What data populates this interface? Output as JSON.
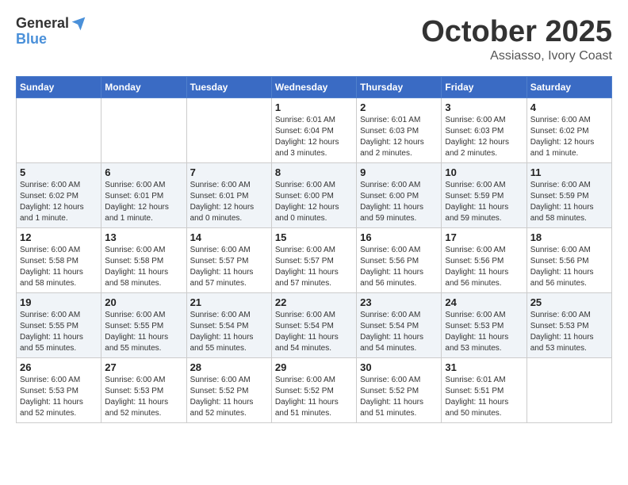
{
  "logo": {
    "general": "General",
    "blue": "Blue"
  },
  "title": "October 2025",
  "location": "Assiasso, Ivory Coast",
  "days_header": [
    "Sunday",
    "Monday",
    "Tuesday",
    "Wednesday",
    "Thursday",
    "Friday",
    "Saturday"
  ],
  "weeks": [
    [
      {
        "day": "",
        "info": ""
      },
      {
        "day": "",
        "info": ""
      },
      {
        "day": "",
        "info": ""
      },
      {
        "day": "1",
        "info": "Sunrise: 6:01 AM\nSunset: 6:04 PM\nDaylight: 12 hours and 3 minutes."
      },
      {
        "day": "2",
        "info": "Sunrise: 6:01 AM\nSunset: 6:03 PM\nDaylight: 12 hours and 2 minutes."
      },
      {
        "day": "3",
        "info": "Sunrise: 6:00 AM\nSunset: 6:03 PM\nDaylight: 12 hours and 2 minutes."
      },
      {
        "day": "4",
        "info": "Sunrise: 6:00 AM\nSunset: 6:02 PM\nDaylight: 12 hours and 1 minute."
      }
    ],
    [
      {
        "day": "5",
        "info": "Sunrise: 6:00 AM\nSunset: 6:02 PM\nDaylight: 12 hours and 1 minute."
      },
      {
        "day": "6",
        "info": "Sunrise: 6:00 AM\nSunset: 6:01 PM\nDaylight: 12 hours and 1 minute."
      },
      {
        "day": "7",
        "info": "Sunrise: 6:00 AM\nSunset: 6:01 PM\nDaylight: 12 hours and 0 minutes."
      },
      {
        "day": "8",
        "info": "Sunrise: 6:00 AM\nSunset: 6:00 PM\nDaylight: 12 hours and 0 minutes."
      },
      {
        "day": "9",
        "info": "Sunrise: 6:00 AM\nSunset: 6:00 PM\nDaylight: 11 hours and 59 minutes."
      },
      {
        "day": "10",
        "info": "Sunrise: 6:00 AM\nSunset: 5:59 PM\nDaylight: 11 hours and 59 minutes."
      },
      {
        "day": "11",
        "info": "Sunrise: 6:00 AM\nSunset: 5:59 PM\nDaylight: 11 hours and 58 minutes."
      }
    ],
    [
      {
        "day": "12",
        "info": "Sunrise: 6:00 AM\nSunset: 5:58 PM\nDaylight: 11 hours and 58 minutes."
      },
      {
        "day": "13",
        "info": "Sunrise: 6:00 AM\nSunset: 5:58 PM\nDaylight: 11 hours and 58 minutes."
      },
      {
        "day": "14",
        "info": "Sunrise: 6:00 AM\nSunset: 5:57 PM\nDaylight: 11 hours and 57 minutes."
      },
      {
        "day": "15",
        "info": "Sunrise: 6:00 AM\nSunset: 5:57 PM\nDaylight: 11 hours and 57 minutes."
      },
      {
        "day": "16",
        "info": "Sunrise: 6:00 AM\nSunset: 5:56 PM\nDaylight: 11 hours and 56 minutes."
      },
      {
        "day": "17",
        "info": "Sunrise: 6:00 AM\nSunset: 5:56 PM\nDaylight: 11 hours and 56 minutes."
      },
      {
        "day": "18",
        "info": "Sunrise: 6:00 AM\nSunset: 5:56 PM\nDaylight: 11 hours and 56 minutes."
      }
    ],
    [
      {
        "day": "19",
        "info": "Sunrise: 6:00 AM\nSunset: 5:55 PM\nDaylight: 11 hours and 55 minutes."
      },
      {
        "day": "20",
        "info": "Sunrise: 6:00 AM\nSunset: 5:55 PM\nDaylight: 11 hours and 55 minutes."
      },
      {
        "day": "21",
        "info": "Sunrise: 6:00 AM\nSunset: 5:54 PM\nDaylight: 11 hours and 55 minutes."
      },
      {
        "day": "22",
        "info": "Sunrise: 6:00 AM\nSunset: 5:54 PM\nDaylight: 11 hours and 54 minutes."
      },
      {
        "day": "23",
        "info": "Sunrise: 6:00 AM\nSunset: 5:54 PM\nDaylight: 11 hours and 54 minutes."
      },
      {
        "day": "24",
        "info": "Sunrise: 6:00 AM\nSunset: 5:53 PM\nDaylight: 11 hours and 53 minutes."
      },
      {
        "day": "25",
        "info": "Sunrise: 6:00 AM\nSunset: 5:53 PM\nDaylight: 11 hours and 53 minutes."
      }
    ],
    [
      {
        "day": "26",
        "info": "Sunrise: 6:00 AM\nSunset: 5:53 PM\nDaylight: 11 hours and 52 minutes."
      },
      {
        "day": "27",
        "info": "Sunrise: 6:00 AM\nSunset: 5:53 PM\nDaylight: 11 hours and 52 minutes."
      },
      {
        "day": "28",
        "info": "Sunrise: 6:00 AM\nSunset: 5:52 PM\nDaylight: 11 hours and 52 minutes."
      },
      {
        "day": "29",
        "info": "Sunrise: 6:00 AM\nSunset: 5:52 PM\nDaylight: 11 hours and 51 minutes."
      },
      {
        "day": "30",
        "info": "Sunrise: 6:00 AM\nSunset: 5:52 PM\nDaylight: 11 hours and 51 minutes."
      },
      {
        "day": "31",
        "info": "Sunrise: 6:01 AM\nSunset: 5:51 PM\nDaylight: 11 hours and 50 minutes."
      },
      {
        "day": "",
        "info": ""
      }
    ]
  ]
}
